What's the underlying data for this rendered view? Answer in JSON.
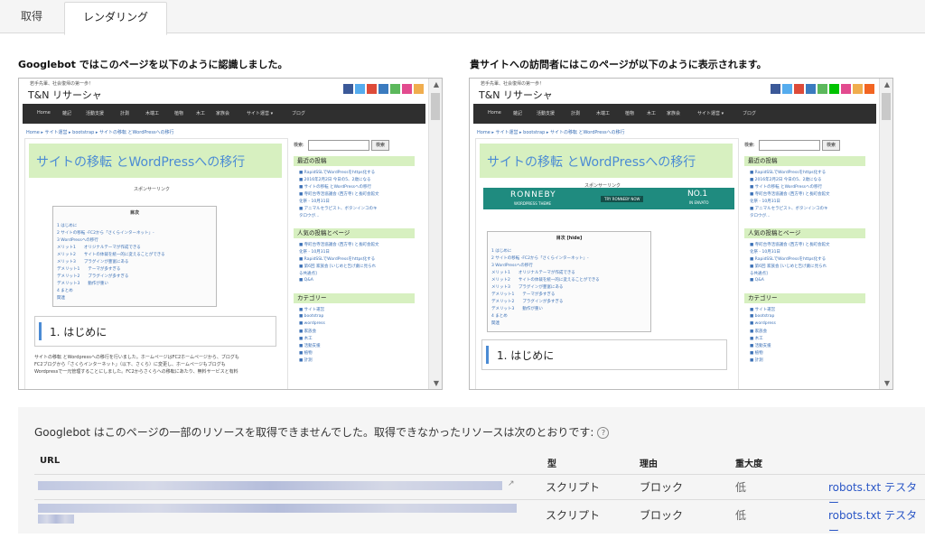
{
  "tabs": [
    {
      "label": "取得"
    },
    {
      "label": "レンダリング"
    }
  ],
  "googlebot_heading": "Googlebot ではこのページを以下のように認識しました。",
  "visitor_heading": "貴サイトへの訪問者にはこのページが以下のように表示されます。",
  "preview": {
    "tagline": "若手先輩、社会復帰の第一歩！",
    "site_title": "T&N リサーシャ",
    "nav": [
      "Home",
      "雑記",
      "活動支援",
      "計測",
      "木端工",
      "植物",
      "木工",
      "家族会",
      "サイト運営 ▾",
      "ブログ"
    ],
    "breadcrumb": "Home ▸ サイト運営 ▸ bootstrap ▸ サイトの移転 とWordPressへの移行",
    "post_title": "サイトの移転 とWordPressへの移行",
    "sponsor": "スポンサーリンク",
    "toc_title": "目次",
    "toc_title_toggle": "目次 [hide]",
    "toc_items": [
      "1  はじめに",
      "2  サイトの移転 -FC2から「さくらインターネット」-",
      "3  WordPressへの移行",
      "     メリット1　　オリジナルテーマが作成できる",
      "     メリット2　　サイトの体裁を統一的に変えることができる",
      "     メリット3　　プラグインが豊富にある",
      "     デメリット1　　テーマが多すぎる",
      "     デメリット2　　プラグインが多すぎる",
      "     デメリット3　　動作が重い",
      "4  まとめ",
      "     関連"
    ],
    "section_title": "1. はじめに",
    "body_lines": [
      "サイトの移転 とWordpressへの移行を行いました。ホームページはFC2ホームページから、ブログも",
      "FC2ブログから「さくらインターネット」（以下、さくら）に変更し、ホームページもブログも",
      "Wordpressで一元管理することにしました。FC2からさくらへの移転にあたり、無料サービスと有料"
    ],
    "search_label": "検索:",
    "search_button": "検索",
    "recent_heading": "最近の投稿",
    "recent_items": [
      "■ RapidSSLでWordPressをhttps化する",
      "■ 2016年2月2日 今日の5、2歳になる",
      "■ サイトの移転 とWordPressへの移行",
      "■ 寺町台寺活協議会 (西方寺) と長町会館文",
      "     化祭 - 10月31日",
      "■ アニマルセラピスト、ボタンインコのキ",
      "     タロウが…"
    ],
    "popular_heading": "人気の投稿とページ",
    "popular_items": [
      "■ 寺町台寺活協議会 (西方寺) と長町会館文",
      "     化祭 - 10月31日",
      "■ RapidSSLでWordPressをhttps化する",
      "■ 第6回 家族会 [いじめと告げ劇に見られ",
      "     る共通点]",
      "■ Q&A"
    ],
    "category_heading": "カテゴリー",
    "category_items": [
      "■ サイト運営",
      "          ■ bootstrap",
      "          ■ wordpress",
      "■ 家族会",
      "■ 木工",
      "■ 活動支援",
      "■ 植物",
      "■ 計測"
    ],
    "ad_brand": "RONNEBY",
    "ad_sub": "WORDPRESS THEME",
    "ad_button": "TRY RONNEBY NOW",
    "ad_right_big": "NO.1",
    "ad_right_small": "IN ENVATO"
  },
  "resources": {
    "message": "Googlebot はこのページの一部のリソースを取得できませんでした。取得できなかったリソースは次のとおりです:",
    "help_icon": "?",
    "columns": {
      "url": "URL",
      "type": "型",
      "reason": "理由",
      "severity": "重大度"
    },
    "rows": [
      {
        "type": "スクリプト",
        "reason": "ブロック",
        "severity": "低",
        "robots": "robots.txt",
        "tester": "テスター"
      },
      {
        "type": "スクリプト",
        "reason": "ブロック",
        "severity": "低",
        "robots": "robots.txt",
        "tester": "テスター"
      }
    ]
  },
  "colors": {
    "link": "#2a56c6",
    "navbar": "#2f2f2f",
    "title_band": "#d7f0c0",
    "accent": "#4b8bd4"
  }
}
